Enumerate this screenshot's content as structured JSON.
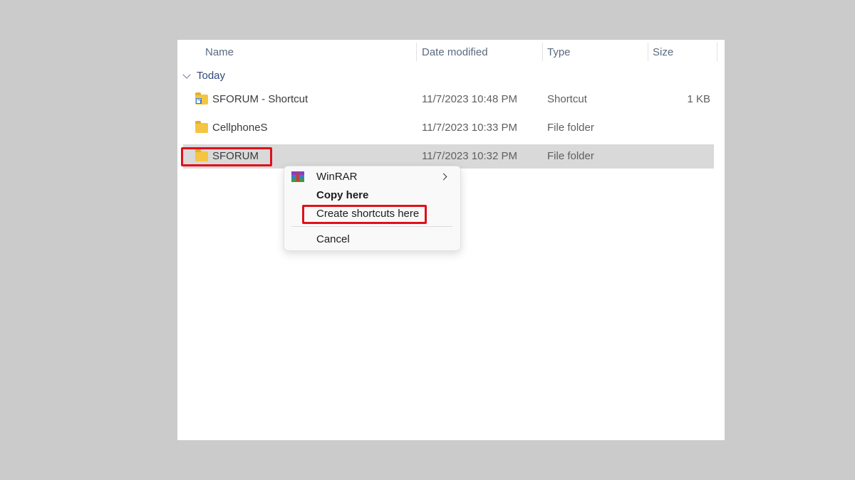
{
  "columns": {
    "name": "Name",
    "date_modified": "Date modified",
    "type": "Type",
    "size": "Size"
  },
  "group": {
    "label": "Today"
  },
  "files": [
    {
      "name": "SFORUM - Shortcut",
      "date": "11/7/2023 10:48 PM",
      "type": "Shortcut",
      "size": "1 KB",
      "icon": "folder-shortcut-icon"
    },
    {
      "name": "CellphoneS",
      "date": "11/7/2023 10:33 PM",
      "type": "File folder",
      "size": "",
      "icon": "folder-icon"
    },
    {
      "name": "SFORUM",
      "date": "11/7/2023 10:32 PM",
      "type": "File folder",
      "size": "",
      "icon": "folder-icon",
      "selected": true
    }
  ],
  "context_menu": {
    "winrar": "WinRAR",
    "copy_here": "Copy here",
    "create_shortcuts_here": "Create shortcuts here",
    "cancel": "Cancel"
  },
  "colors": {
    "highlight": "#e0101a",
    "selection": "#d9d9d9",
    "folder": "#f4c542"
  }
}
